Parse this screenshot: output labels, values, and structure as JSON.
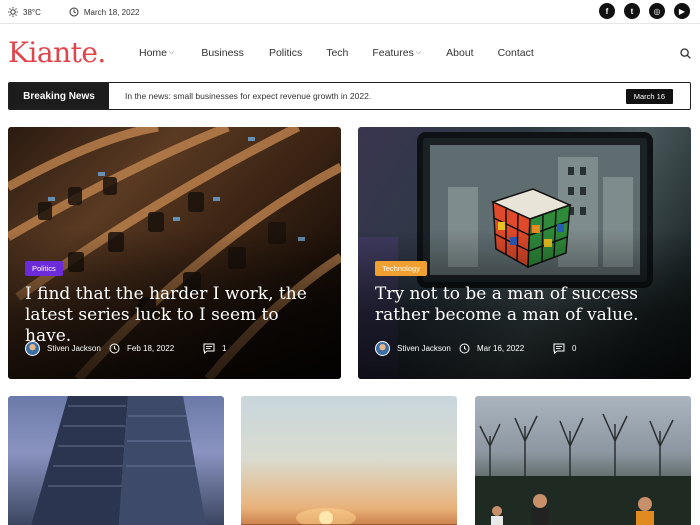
{
  "topbar": {
    "temperature": "38°C",
    "date": "March 18, 2022",
    "social": [
      {
        "name": "facebook-icon",
        "glyph": "f"
      },
      {
        "name": "twitter-icon",
        "glyph": "t"
      },
      {
        "name": "instagram-icon",
        "glyph": "◎"
      },
      {
        "name": "youtube-icon",
        "glyph": "▶"
      }
    ]
  },
  "header": {
    "logo": "Kiante.",
    "nav": [
      {
        "label": "Home",
        "dropdown": true
      },
      {
        "label": "Business",
        "dropdown": false
      },
      {
        "label": "Politics",
        "dropdown": false
      },
      {
        "label": "Tech",
        "dropdown": false
      },
      {
        "label": "Features",
        "dropdown": true
      },
      {
        "label": "About",
        "dropdown": false
      },
      {
        "label": "Contact",
        "dropdown": false
      }
    ]
  },
  "breaking": {
    "label": "Breaking News",
    "text": "In the news: small businesses for expect revenue growth in 2022.",
    "date": "March 16"
  },
  "featured": [
    {
      "category": "Politics",
      "category_color": "#6c2bd9",
      "title": "I find that the harder I work, the latest series luck to I seem to have.",
      "author": "Stiven Jackson",
      "date": "Feb 18, 2022",
      "comments": "1"
    },
    {
      "category": "Technology",
      "category_color": "#f0a030",
      "title": "Try not to be a man of success rather become a man of value.",
      "author": "Stiven Jackson",
      "date": "Mar 16, 2022",
      "comments": "0"
    }
  ]
}
